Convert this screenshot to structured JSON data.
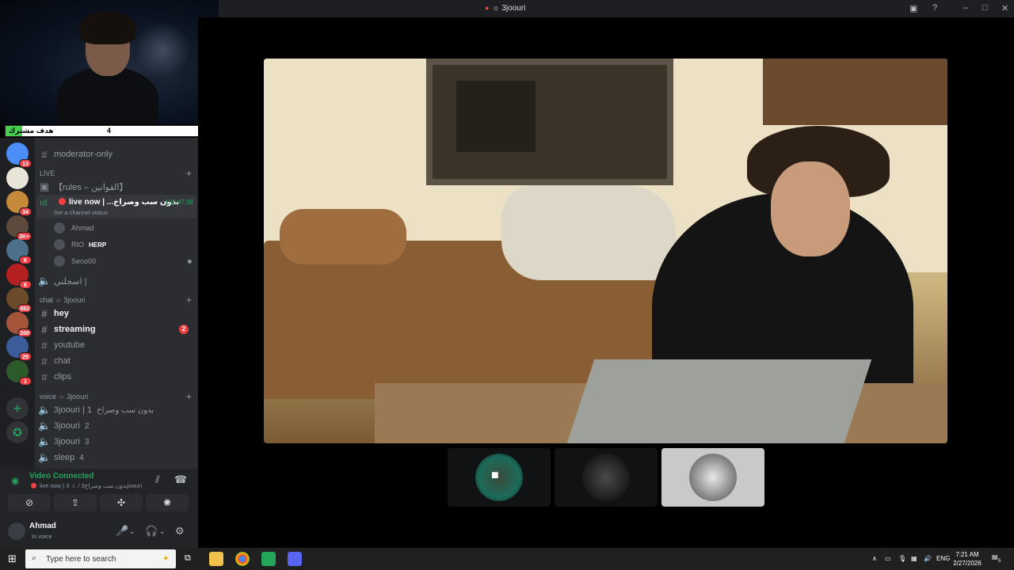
{
  "overlay": {
    "goal": {
      "label": "هدف مشترك",
      "current": "4",
      "max": "50",
      "progress_fraction": 0.08
    }
  },
  "servers": [
    {
      "badge": "13",
      "color": "#4c8ef7"
    },
    {
      "badge": "",
      "color": "#e9e4d8"
    },
    {
      "badge": "34",
      "color": "#c58b3a"
    },
    {
      "badge": "2K+",
      "color": "#5d4a3c"
    },
    {
      "badge": "6",
      "color": "#4c6f8a"
    },
    {
      "badge": "6",
      "color": "#b52020"
    },
    {
      "badge": "862",
      "color": "#6b4b2a"
    },
    {
      "badge": "200",
      "color": "#a4553a"
    },
    {
      "badge": "29",
      "color": "#3b5b9a"
    },
    {
      "badge": "1",
      "color": "#2c5a2a"
    }
  ],
  "sidebar": {
    "top_channel": "moderator-only",
    "live_category": "LIVE",
    "rules_channel": "【rules – القوانين】",
    "live_title": "live now | ...بدون سب وصراخ",
    "live_time": "101:47:39",
    "live_status": "Set a channel status",
    "members": [
      {
        "name": "Ahmad",
        "tag": ""
      },
      {
        "name": "RIO",
        "tag": "HERP"
      },
      {
        "name": "Seno00",
        "tag": ""
      }
    ],
    "voice_extra": "اسجلني |",
    "chat_category": "chat ☼ 3joouri",
    "text_channels": [
      {
        "name": "hey",
        "bold": true,
        "mentions": ""
      },
      {
        "name": "streaming",
        "bold": true,
        "mentions": "2"
      },
      {
        "name": "youtube",
        "bold": false,
        "mentions": ""
      },
      {
        "name": "chat",
        "bold": false,
        "mentions": ""
      },
      {
        "name": "clips",
        "bold": false,
        "mentions": ""
      }
    ],
    "voice_category": "voice ☼ 3joouri",
    "voice_channels": [
      {
        "name": "3joouri | 1",
        "sub": "بدون سب وصراخ"
      },
      {
        "name": "3joouri",
        "sub": "2"
      },
      {
        "name": "3joouri",
        "sub": "3"
      },
      {
        "name": "sleep",
        "sub": "4"
      }
    ]
  },
  "voice_panel": {
    "status": "Video Connected",
    "channel": "live now | 3 ☼ / بدون سب وصراخ3joouri"
  },
  "user": {
    "name": "Ahmad",
    "status": "In voice"
  },
  "window": {
    "title": "☼ 3joouri"
  },
  "taskbar": {
    "search_placeholder": "Type here to search",
    "lang": "ENG",
    "time": "7:21 AM",
    "date": "2/27/2026",
    "notifications": "5"
  }
}
